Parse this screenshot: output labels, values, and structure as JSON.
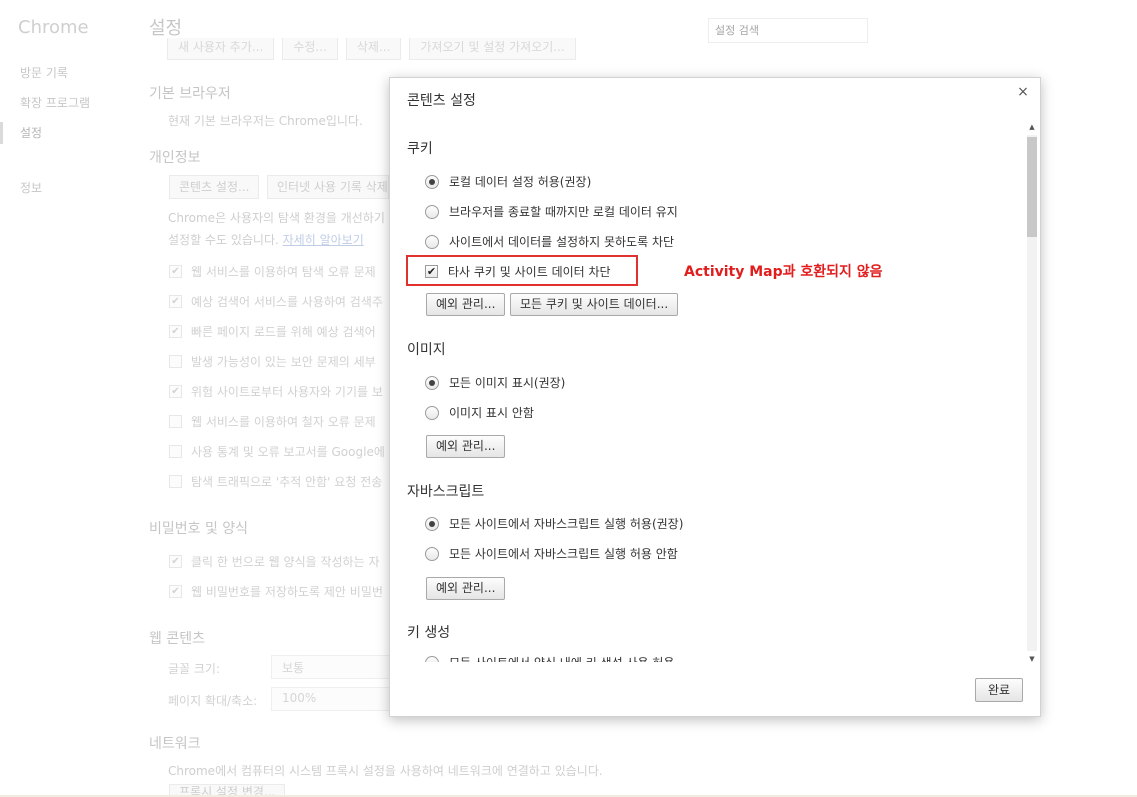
{
  "app": {
    "brand": "Chrome",
    "page_title": "설정",
    "search_placeholder": "설정 검색"
  },
  "sidebar": {
    "items": [
      {
        "label": "방문 기록"
      },
      {
        "label": "확장 프로그램"
      },
      {
        "label": "설정"
      },
      {
        "label": "정보"
      }
    ]
  },
  "bg": {
    "top_buttons": [
      "새 사용자 추가...",
      "수정...",
      "삭제...",
      "가져오기 및 설정 가져오기..."
    ],
    "default_browser": {
      "heading": "기본 브라우저",
      "text": "현재 기본 브라우저는 Chrome입니다."
    },
    "privacy": {
      "heading": "개인정보",
      "content_settings_button": "콘텐츠 설정...",
      "clear_data_button": "인터넷 사용 기록 삭제...",
      "desc_line1": "Chrome은 사용자의 탐색 환경을 개선하기",
      "desc_line2": "설정할 수도 있습니다.",
      "learn_more": "자세히 알아보기",
      "checkboxes": [
        {
          "label": "웹 서비스를 이용하여 탐색 오류 문제",
          "checked": true
        },
        {
          "label": "예상 검색어 서비스를 사용하여 검색주",
          "checked": true
        },
        {
          "label": "빠른 페이지 로드를 위해 예상 검색어",
          "checked": true
        },
        {
          "label": "발생 가능성이 있는 보안 문제의 세부",
          "checked": false
        },
        {
          "label": "위험 사이트로부터 사용자와 기기를 보",
          "checked": true
        },
        {
          "label": "웹 서비스를 이용하여 철자 오류 문제",
          "checked": false
        },
        {
          "label": "사용 통계 및 오류 보고서를 Google에",
          "checked": false
        },
        {
          "label": "탐색 트래픽으로 '추적 안함' 요청 전송",
          "checked": false
        }
      ]
    },
    "passwords": {
      "heading": "비밀번호 및 양식",
      "checkboxes": [
        {
          "label": "클릭 한 번으로 웹 양식을 작성하는 자",
          "checked": true
        },
        {
          "label": "웹 비밀번호를 저장하도록 제안 비밀번",
          "checked": true
        }
      ]
    },
    "web_content": {
      "heading": "웹 콘텐츠",
      "font_size_label": "글꼴 크기:",
      "font_size_value": "보통",
      "zoom_label": "페이지 확대/축소:",
      "zoom_value": "100%"
    },
    "network": {
      "heading": "네트워크",
      "text": "Chrome에서 컴퓨터의 시스템 프록시 설정을 사용하여 네트워크에 연결하고 있습니다.",
      "proxy_button": "프록시 설정 변경..."
    }
  },
  "dialog": {
    "title": "콘텐츠 설정",
    "close_glyph": "×",
    "done_label": "완료",
    "cookies": {
      "heading": "쿠키",
      "radios": [
        {
          "label": "로컬 데이터 설정 허용(권장)",
          "selected": true
        },
        {
          "label": "브라우저를 종료할 때까지만 로컬 데이터 유지",
          "selected": false
        },
        {
          "label": "사이트에서 데이터를 설정하지 못하도록 차단",
          "selected": false
        }
      ],
      "block_third_party": {
        "label": "타사 쿠키 및 사이트 데이터 차단",
        "checked": true
      },
      "annotation": "Activity Map과 호환되지 않음",
      "exceptions_button": "예외 관리...",
      "all_cookies_button": "모든 쿠키 및 사이트 데이터..."
    },
    "images": {
      "heading": "이미지",
      "radios": [
        {
          "label": "모든 이미지 표시(권장)",
          "selected": true
        },
        {
          "label": "이미지 표시 안함",
          "selected": false
        }
      ],
      "exceptions_button": "예외 관리..."
    },
    "javascript": {
      "heading": "자바스크립트",
      "radios": [
        {
          "label": "모든 사이트에서 자바스크립트 실행 허용(권장)",
          "selected": true
        },
        {
          "label": "모든 사이트에서 자바스크립트 실행 허용 안함",
          "selected": false
        }
      ],
      "exceptions_button": "예외 관리..."
    },
    "keygen": {
      "heading": "키 생성",
      "radios": [
        {
          "label": "모든 사이트에서 양식 내에 키 생성 사용 허용",
          "selected": false
        }
      ]
    }
  },
  "colors": {
    "annotation_red": "#e11d1d",
    "highlight_border": "#e0312f"
  }
}
